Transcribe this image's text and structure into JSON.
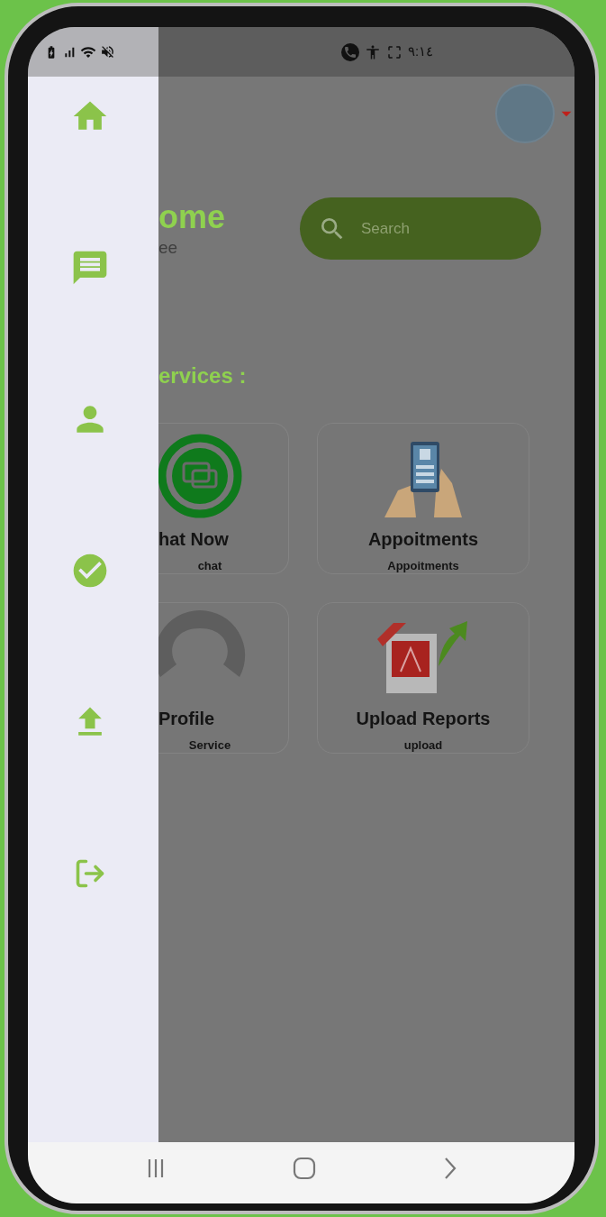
{
  "status_bar": {
    "time": "٩:١٤"
  },
  "drawer": {
    "items": [
      {
        "kind": "home"
      },
      {
        "kind": "chat"
      },
      {
        "kind": "person"
      },
      {
        "kind": "check"
      },
      {
        "kind": "upload"
      },
      {
        "kind": "logout"
      }
    ]
  },
  "welcome": {
    "title": "ome",
    "subtitle": "ee"
  },
  "search": {
    "placeholder": "Search"
  },
  "section_title": "ervices :",
  "services": [
    {
      "kind": "chat",
      "title": "hat Now",
      "subtitle": "chat"
    },
    {
      "kind": "appointment",
      "title": "Appoitments",
      "subtitle": "Appoitments"
    },
    {
      "kind": "profile",
      "title": "Profile",
      "subtitle": "Service"
    },
    {
      "kind": "upload",
      "title": "Upload Reports",
      "subtitle": "upload"
    }
  ]
}
